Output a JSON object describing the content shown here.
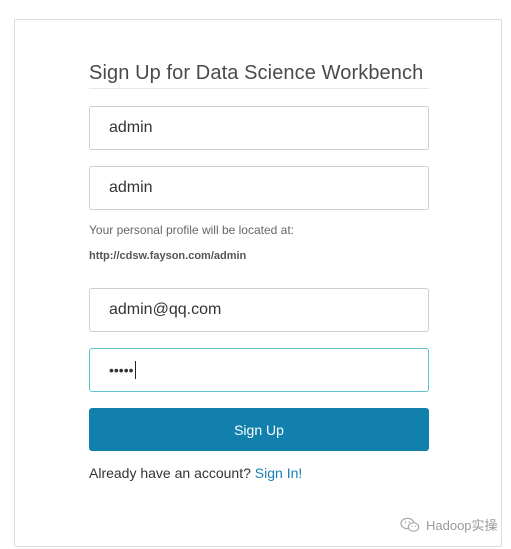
{
  "signup": {
    "title": "Sign Up for Data Science Workbench",
    "full_name_value": "admin",
    "username_value": "admin",
    "profile_hint": "Your personal profile will be located at:",
    "profile_url": "http://cdsw.fayson.com/admin",
    "email_value": "admin@qq.com",
    "password_masked": "•••••",
    "submit_label": "Sign Up",
    "account_prompt": "Already have an account?",
    "signin_link": "Sign In!"
  },
  "watermark": {
    "text": "Hadoop实操"
  },
  "colors": {
    "button": "#1180ad",
    "link": "#1a7fb3",
    "focus_border": "#5fc3cf"
  }
}
